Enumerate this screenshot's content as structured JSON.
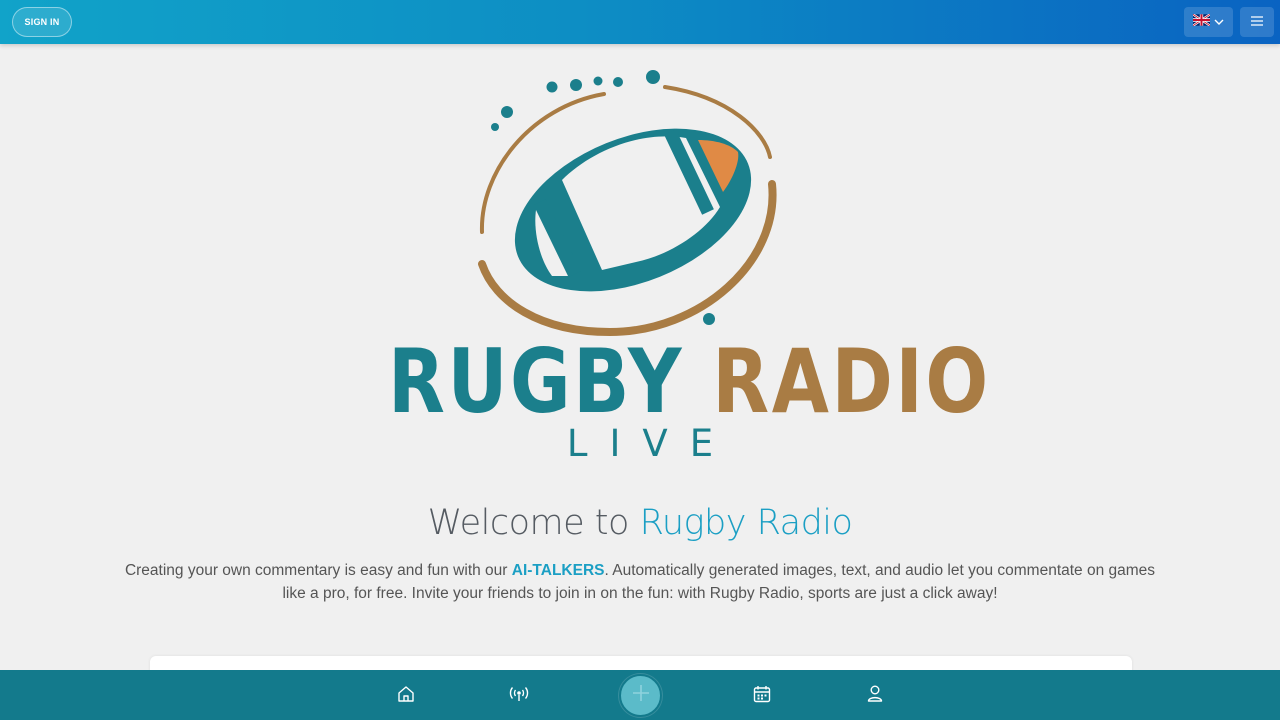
{
  "header": {
    "signin_label": "SIGN IN",
    "language_icon": "uk-flag-icon",
    "language_dropdown_icon": "chevron-down-icon",
    "menu_icon": "hamburger-menu-icon"
  },
  "logo": {
    "word1": "RUGBY",
    "word2": "RADIO",
    "subtitle": "LIVE",
    "colors": {
      "teal": "#1b7f8c",
      "bronze": "#a97c44",
      "orange": "#e08a45"
    }
  },
  "welcome": {
    "prefix": "Welcome to ",
    "brand": "Rugby Radio"
  },
  "intro": {
    "part1": "Creating your own commentary is easy and fun with our ",
    "highlight": "AI-TALKERS",
    "part2": ". Automatically generated images, text, and audio let you commentate on games like a pro, for free. Invite your friends to join in on the fun: with Rugby Radio, sports are just a click away!"
  },
  "bottom_nav": {
    "items": [
      {
        "icon": "home-icon"
      },
      {
        "icon": "broadcast-icon"
      },
      {
        "icon": "add-icon"
      },
      {
        "icon": "calendar-icon"
      },
      {
        "icon": "user-icon"
      }
    ],
    "background": "#137a8c"
  }
}
